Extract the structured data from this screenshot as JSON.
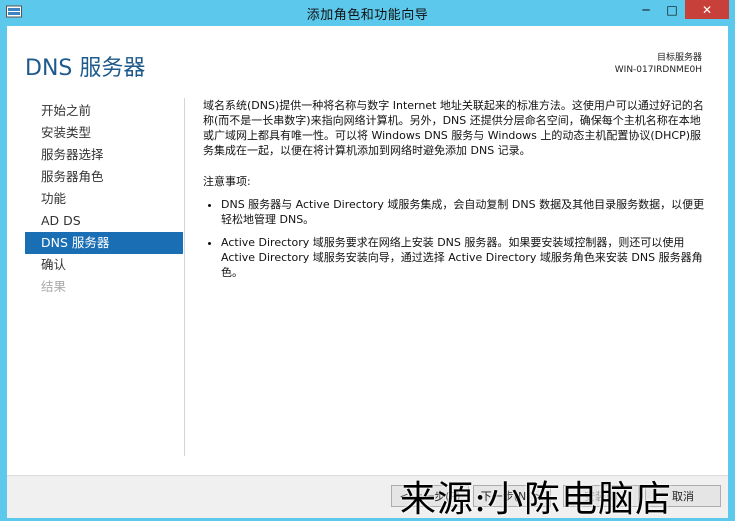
{
  "window": {
    "title": "添加角色和功能向导",
    "buttons": {
      "minimize": "─",
      "maximize": "□",
      "close": "✕"
    }
  },
  "page": {
    "title": "DNS 服务器",
    "target_label": "目标服务器",
    "target_server": "WIN-017IRDNME0H"
  },
  "nav": {
    "items": [
      {
        "label": "开始之前",
        "state": "normal"
      },
      {
        "label": "安装类型",
        "state": "normal"
      },
      {
        "label": "服务器选择",
        "state": "normal"
      },
      {
        "label": "服务器角色",
        "state": "normal"
      },
      {
        "label": "功能",
        "state": "normal"
      },
      {
        "label": "AD DS",
        "state": "normal"
      },
      {
        "label": "DNS 服务器",
        "state": "active"
      },
      {
        "label": "确认",
        "state": "normal"
      },
      {
        "label": "结果",
        "state": "disabled"
      }
    ]
  },
  "content": {
    "intro": "域名系统(DNS)提供一种将名称与数字 Internet 地址关联起来的标准方法。这使用户可以通过好记的名称(而不是一长串数字)来指向网络计算机。另外，DNS 还提供分层命名空间，确保每个主机名称在本地或广域网上都具有唯一性。可以将 Windows DNS 服务与 Windows 上的动态主机配置协议(DHCP)服务集成在一起，以便在将计算机添加到网络时避免添加 DNS 记录。",
    "notes_heading": "注意事项:",
    "notes": [
      "DNS 服务器与 Active Directory 域服务集成，会自动复制 DNS 数据及其他目录服务数据，以便更轻松地管理 DNS。",
      "Active Directory 域服务要求在网络上安装 DNS 服务器。如果要安装域控制器，则还可以使用 Active Directory 域服务安装向导，通过选择 Active Directory 域服务角色来安装 DNS 服务器角色。"
    ]
  },
  "footer": {
    "prev": "< 上一步(P)",
    "next": "下一步(N) >",
    "install": "安装(I)",
    "cancel": "取消"
  },
  "watermark": "来源:小陈电脑店"
}
